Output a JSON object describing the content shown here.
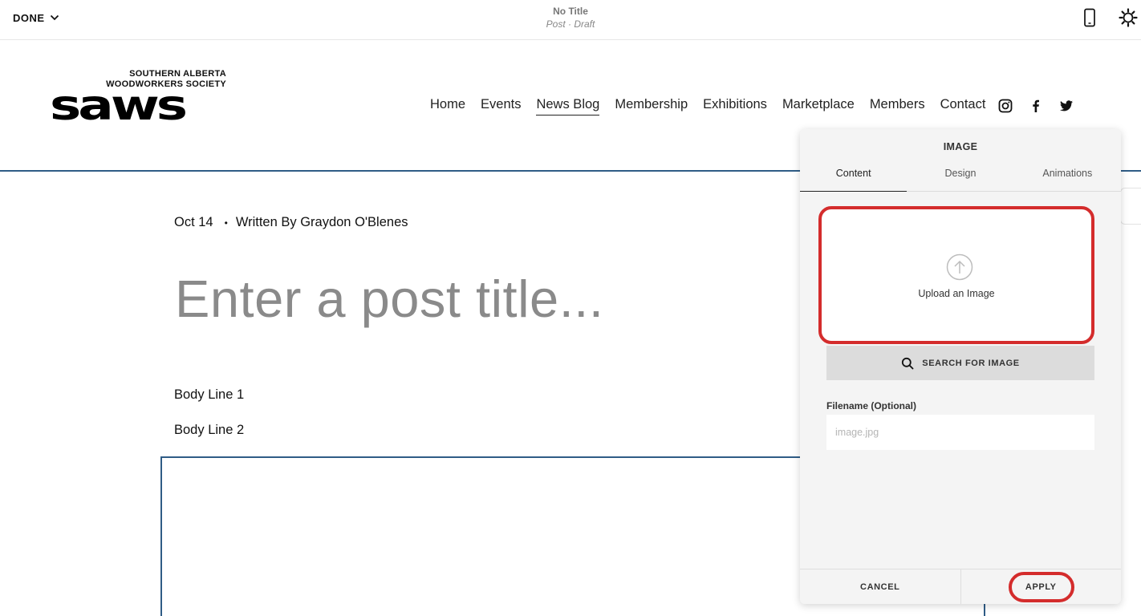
{
  "topbar": {
    "done_label": "DONE",
    "page_title": "No Title",
    "page_status": "Post · Draft"
  },
  "site": {
    "logo_line1": "SOUTHERN ALBERTA",
    "logo_line2": "WOODWORKERS SOCIETY",
    "logo_main": "saws",
    "nav": [
      "Home",
      "Events",
      "News Blog",
      "Membership",
      "Exhibitions",
      "Marketplace",
      "Members",
      "Contact"
    ],
    "active_nav": "News Blog",
    "social_icons": [
      "instagram-icon",
      "facebook-icon",
      "twitter-icon"
    ]
  },
  "post": {
    "date": "Oct 14",
    "author": "Written By Graydon O'Blenes",
    "title_placeholder": "Enter a post title...",
    "body_lines": [
      "Body Line 1",
      "Body Line 2"
    ]
  },
  "panel": {
    "title": "IMAGE",
    "tabs": [
      "Content",
      "Design",
      "Animations"
    ],
    "active_tab": "Content",
    "upload_label": "Upload an Image",
    "search_label": "SEARCH FOR IMAGE",
    "filename_label": "Filename (Optional)",
    "filename_placeholder": "image.jpg",
    "filename_value": "",
    "cancel_label": "CANCEL",
    "apply_label": "APPLY",
    "highlight_color": "#d42c2c"
  },
  "colors": {
    "accent_border": "#2f5c86",
    "title_placeholder": "#8a8a8a"
  }
}
